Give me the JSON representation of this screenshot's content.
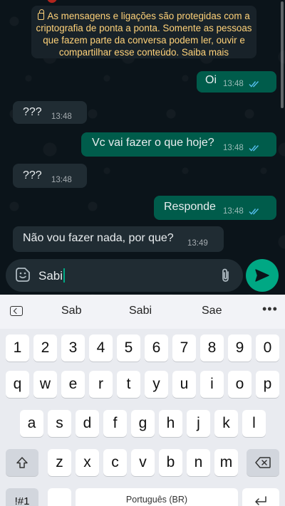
{
  "encryption_notice": "As mensagens e ligações são protegidas com a criptografia de ponta a ponta. Somente as pessoas que fazem parte da conversa podem ler, ouvir e compartilhar esse conteúdo. Saiba mais",
  "messages": [
    {
      "direction": "out",
      "text": "Oi",
      "time": "13:48",
      "status": "read"
    },
    {
      "direction": "in",
      "text": "???",
      "time": "13:48"
    },
    {
      "direction": "out",
      "text": "Vc vai fazer o que hoje?",
      "time": "13:48",
      "status": "read"
    },
    {
      "direction": "in",
      "text": "???",
      "time": "13:48"
    },
    {
      "direction": "out",
      "text": "Responde",
      "time": "13:48",
      "status": "read"
    },
    {
      "direction": "in",
      "text": "Não vou fazer nada, por que?",
      "time": "13:49"
    }
  ],
  "composer": {
    "text": "Sabi",
    "send_icon": "send-icon",
    "emoji_icon": "sticker-icon",
    "attach_icon": "paperclip-icon"
  },
  "keyboard": {
    "suggestions": [
      "Sab",
      "Sabi",
      "Sae"
    ],
    "row_numbers": [
      "1",
      "2",
      "3",
      "4",
      "5",
      "6",
      "7",
      "8",
      "9",
      "0"
    ],
    "row1": [
      "q",
      "w",
      "e",
      "r",
      "t",
      "y",
      "u",
      "i",
      "o",
      "p"
    ],
    "row2": [
      "a",
      "s",
      "d",
      "f",
      "g",
      "h",
      "j",
      "k",
      "l"
    ],
    "row3": [
      "z",
      "x",
      "c",
      "v",
      "b",
      "n",
      "m"
    ],
    "symbols_label": "!#1",
    "space_label": "Português (BR)"
  },
  "colors": {
    "outgoing": "#005c4b",
    "incoming": "#202c33",
    "accent": "#00a884",
    "read_ticks": "#53bdeb",
    "notice_text": "#ffd279"
  }
}
